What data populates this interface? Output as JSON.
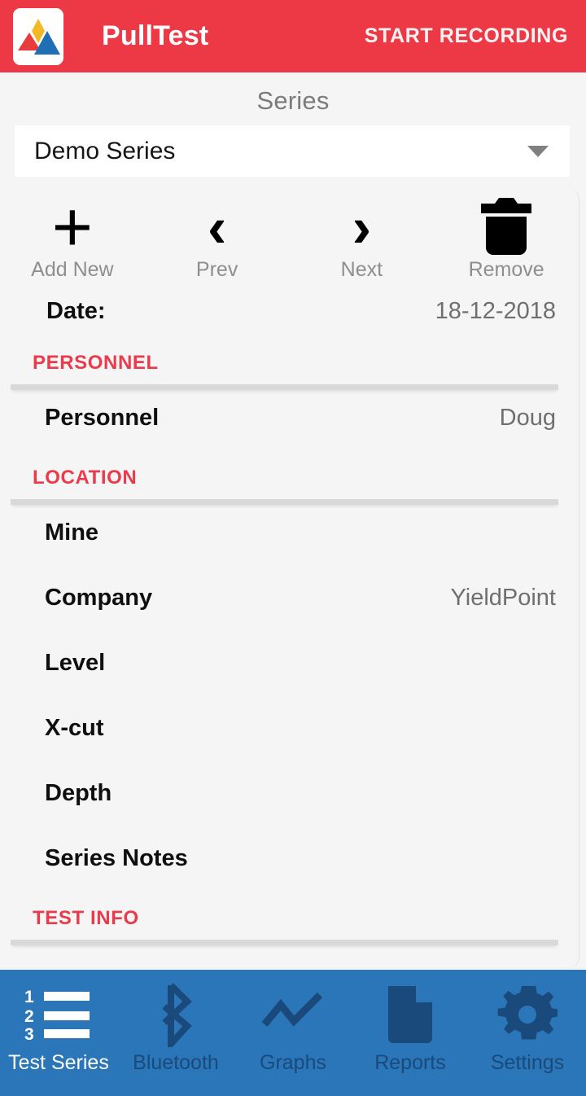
{
  "appbar": {
    "logo_icon": "pulltest-logo-icon",
    "title": "PullTest",
    "record_button": "START RECORDING",
    "background_color": "#ed3845"
  },
  "series": {
    "label": "Series",
    "selected": "Demo Series",
    "caret_icon": "chevron-down-icon"
  },
  "actions": [
    {
      "icon": "plus-icon",
      "label": "Add New"
    },
    {
      "icon": "chevron-left-icon",
      "label": "Prev"
    },
    {
      "icon": "chevron-right-icon",
      "label": "Next"
    },
    {
      "icon": "trash-icon",
      "label": "Remove"
    }
  ],
  "date_row": {
    "label": "Date:",
    "value": "18-12-2018"
  },
  "sections": [
    {
      "heading": "PERSONNEL",
      "rows": [
        {
          "label": "Personnel",
          "value": "Doug"
        }
      ]
    },
    {
      "heading": "LOCATION",
      "rows": [
        {
          "label": "Mine",
          "value": ""
        },
        {
          "label": "Company",
          "value": "YieldPoint"
        },
        {
          "label": "Level",
          "value": ""
        },
        {
          "label": "X-cut",
          "value": ""
        },
        {
          "label": "Depth",
          "value": ""
        },
        {
          "label": "Series Notes",
          "value": ""
        }
      ]
    },
    {
      "heading": "TEST INFO",
      "rows": []
    }
  ],
  "bottom_nav": {
    "background_color": "#2a76b8",
    "active_color": "#ffffff",
    "inactive_color": "#194a7b",
    "items": [
      {
        "icon": "numbered-list-icon",
        "label": "Test Series",
        "active": true
      },
      {
        "icon": "bluetooth-icon",
        "label": "Bluetooth",
        "active": false
      },
      {
        "icon": "line-graph-icon",
        "label": "Graphs",
        "active": false
      },
      {
        "icon": "document-icon",
        "label": "Reports",
        "active": false
      },
      {
        "icon": "gear-icon",
        "label": "Settings",
        "active": false
      }
    ]
  },
  "accent_colors": {
    "header_red": "#ed3845",
    "section_red": "#eb3b4a",
    "nav_blue": "#2a76b8",
    "nav_dark": "#194a7b",
    "value_gray": "#6f6f6f"
  }
}
